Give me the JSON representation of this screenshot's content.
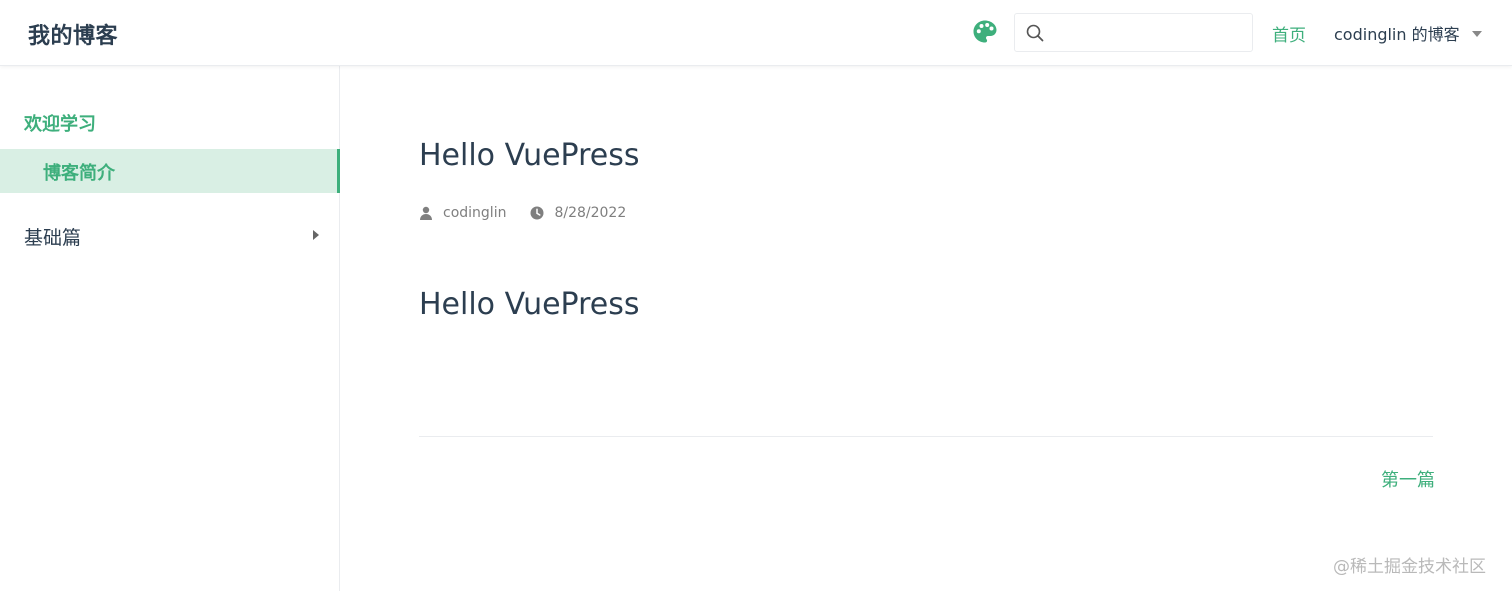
{
  "navbar": {
    "site_title": "我的博客",
    "search": {
      "value": "",
      "placeholder": ""
    },
    "links": [
      {
        "label": "首页",
        "active": true
      }
    ],
    "dropdown": {
      "label": "codinglin 的博客"
    },
    "accent_color": "#3eaf7c",
    "icons": {
      "theme": "palette-icon",
      "search": "search-icon",
      "dropdown": "chevron-down-icon"
    }
  },
  "sidebar": {
    "groups": [
      {
        "title": "欢迎学习",
        "expanded": true,
        "items": [
          {
            "label": "博客简介",
            "active": true
          }
        ]
      },
      {
        "title": "基础篇",
        "expanded": false,
        "items": []
      }
    ]
  },
  "page": {
    "title": "Hello VuePress",
    "meta": {
      "author": "codinglin",
      "date": "8/28/2022",
      "author_icon": "user-icon",
      "date_icon": "clock-icon"
    },
    "heading": "Hello VuePress",
    "next_link": "第一篇"
  },
  "watermark": "@稀土掘金技术社区"
}
